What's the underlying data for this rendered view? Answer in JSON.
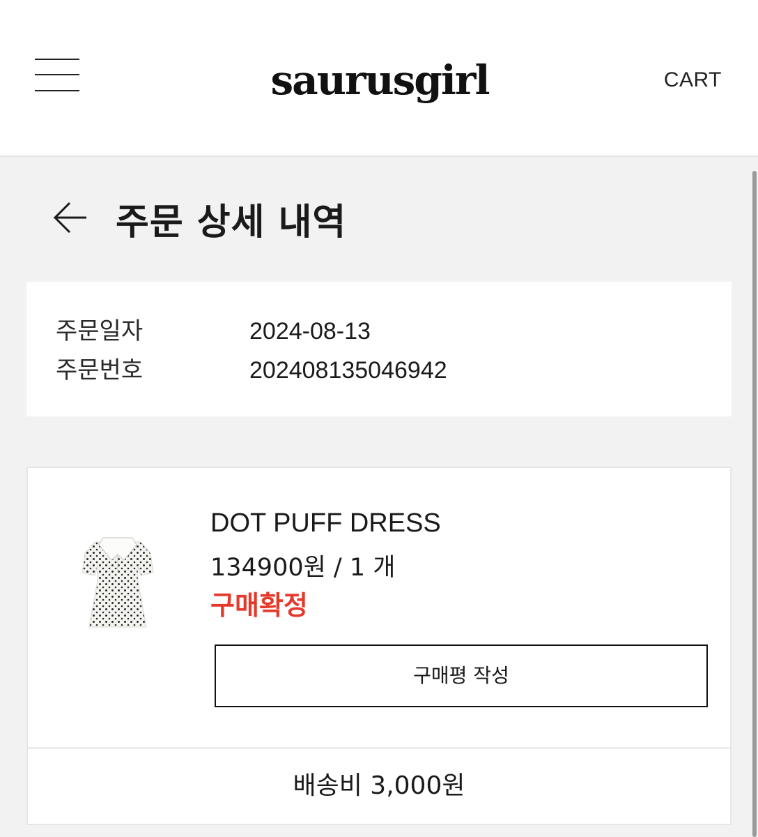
{
  "header": {
    "menu_icon": "hamburger-icon",
    "logo": "saurusgirl",
    "cart_label": "CART"
  },
  "page": {
    "back_icon": "arrow-left-icon",
    "title": "주문 상세 내역"
  },
  "order_info": {
    "rows": [
      {
        "label": "주문일자",
        "value": "2024-08-13"
      },
      {
        "label": "주문번호",
        "value": "202408135046942"
      }
    ]
  },
  "order_item": {
    "image_icon": "dress-thumbnail",
    "name": "DOT PUFF DRESS",
    "price_quantity": "134900원 / 1 개",
    "status": "구매확정",
    "review_button_label": "구매평 작성",
    "shipping_fee": "배송비 3,000원"
  },
  "colors": {
    "status_red": "#e53a2b",
    "background": "#f2f2f2",
    "card": "#ffffff"
  }
}
